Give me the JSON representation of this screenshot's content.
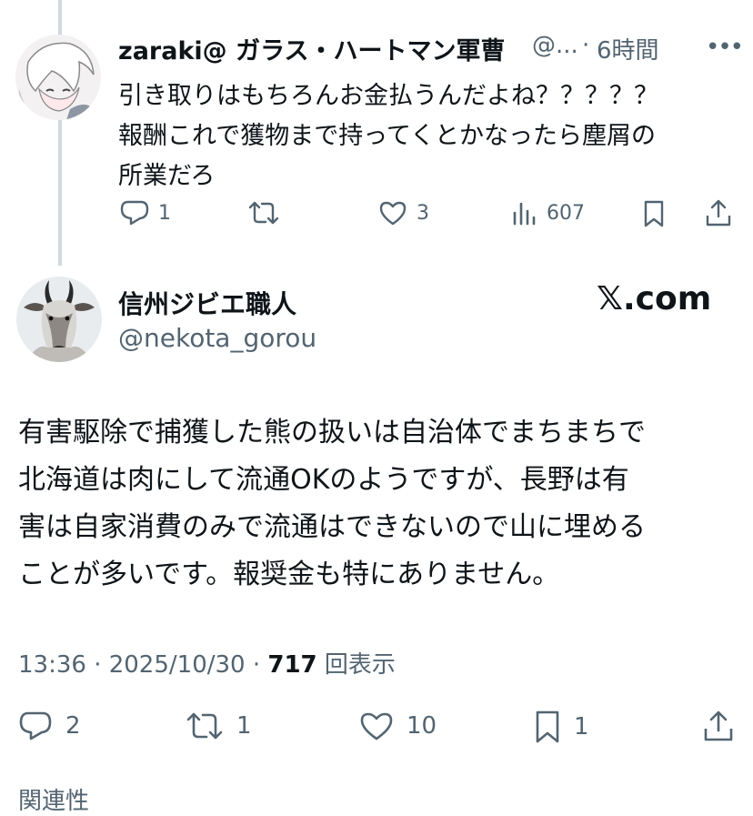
{
  "reply": {
    "author_name": "zaraki@ ガラス・ハートマン軍曹",
    "handle": "@...",
    "separator": "·",
    "time": "6時間",
    "more": "•••",
    "body_lines": [
      "引き取りはもちろんお金払うんだよね？？？？？",
      "報酬これで獲物まで持ってくとかなったら塵屑の",
      "所業だろ"
    ],
    "actions": {
      "replies": "1",
      "retweets": "",
      "likes": "3",
      "views": "607"
    }
  },
  "tweet": {
    "author_name": "信州ジビエ職人",
    "handle": "@nekota_gorou",
    "watermark": "𝕏.com",
    "body_lines": [
      "有害駆除で捕獲した熊の扱いは自治体でまちまちで",
      "北海道は肉にして流通OKのようですが、長野は有",
      "害は自家消費のみで流通はできないので山に埋める",
      "ことが多いです。報奨金も特にありません。"
    ],
    "timestamp": "13:36 · 2025/10/30 · ",
    "view_count": "717",
    "view_label": " 回表示",
    "actions": {
      "replies": "2",
      "retweets": "1",
      "likes": "10",
      "bookmarks": "1"
    },
    "cut_text": "関連性"
  },
  "colors": {
    "text": "#0f1419",
    "muted": "#536471",
    "thread_line": "#cfd9de"
  }
}
